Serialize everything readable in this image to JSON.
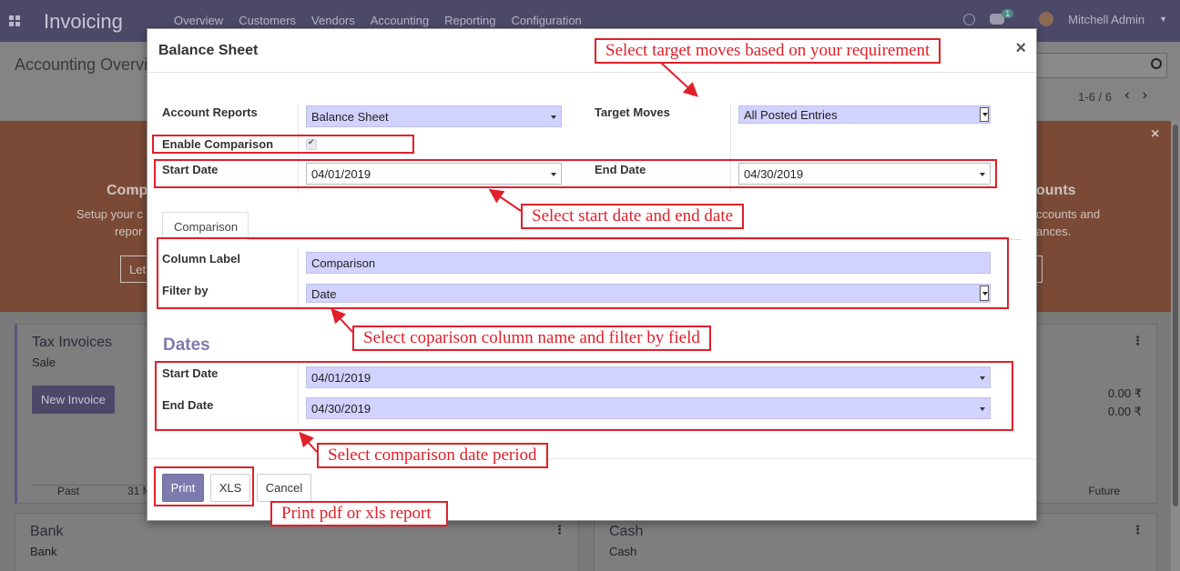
{
  "app": {
    "brand": "Invoicing",
    "menu": [
      "Overview",
      "Customers",
      "Vendors",
      "Accounting",
      "Reporting",
      "Configuration"
    ],
    "chat_count": "1",
    "user": "Mitchell Admin"
  },
  "control_panel": {
    "title": "Accounting Overvi",
    "pager": "1-6 / 6"
  },
  "banner": {
    "left_title": "Comp",
    "left_line1": "Setup your c",
    "left_line2": "repor",
    "left_button": "Let",
    "right_title": "ounts",
    "right_line1": "ccounts and",
    "right_line2": "ances.",
    "close": "×"
  },
  "dashboard": {
    "tax_invoices": {
      "title": "Tax Invoices",
      "subtitle": "Sale",
      "button": "New Invoice",
      "past": "Past",
      "date_label": "31 M",
      "future": "Future"
    },
    "amount1": "0.00 ₹",
    "amount2": "0.00 ₹",
    "bank": {
      "title": "Bank",
      "subtitle": "Bank"
    },
    "cash": {
      "title": "Cash",
      "subtitle": "Cash"
    }
  },
  "modal": {
    "title": "Balance Sheet",
    "close": "×",
    "account_reports_label": "Account Reports",
    "account_reports_value": "Balance Sheet",
    "target_moves_label": "Target Moves",
    "target_moves_value": "All Posted Entries",
    "enable_comparison_label": "Enable Comparison",
    "start_date_label": "Start Date",
    "start_date_value": "04/01/2019",
    "end_date_label": "End Date",
    "end_date_value": "04/30/2019",
    "tab_label": "Comparison",
    "column_label_label": "Column Label",
    "column_label_value": "Comparison",
    "filter_by_label": "Filter by",
    "filter_by_value": "Date",
    "dates_heading": "Dates",
    "cmp_start_date_label": "Start Date",
    "cmp_start_date_value": "04/01/2019",
    "cmp_end_date_label": "End Date",
    "cmp_end_date_value": "04/30/2019",
    "print_button": "Print",
    "xls_button": "XLS",
    "cancel_button": "Cancel"
  },
  "annotations": {
    "target_moves": "Select target moves based on your requirement",
    "start_end_date": "Select start date and end date",
    "comparison_column": "Select coparison column name and filter by field",
    "comparison_period": "Select comparison date period",
    "print_report": "Print pdf or xls report"
  },
  "colors": {
    "navbar": "#4c4868",
    "accent": "#7c7bad",
    "field_bg": "#d2d2ff",
    "annotation_red": "#e0202a"
  }
}
